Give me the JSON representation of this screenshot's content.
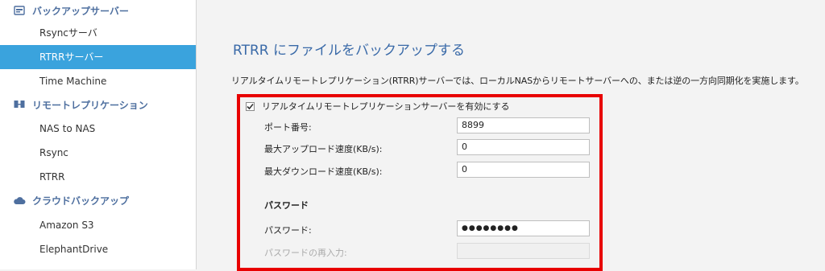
{
  "sidebar": {
    "groups": [
      {
        "label": "バックアップサーバー",
        "icon": "backup-server-icon",
        "items": [
          "Rsyncサーバ",
          "RTRRサーバー",
          "Time Machine"
        ]
      },
      {
        "label": "リモートレプリケーション",
        "icon": "remote-replication-icon",
        "items": [
          "NAS to NAS",
          "Rsync",
          "RTRR"
        ]
      },
      {
        "label": "クラウドバックアップ",
        "icon": "cloud-icon",
        "items": [
          "Amazon S3",
          "ElephantDrive"
        ]
      }
    ],
    "active_item": "RTRRサーバー"
  },
  "main": {
    "title": "RTRR にファイルをバックアップする",
    "description": "リアルタイムリモートレプリケーション(RTRR)サーバーでは、ローカルNASからリモートサーバーへの、または逆の一方向同期化を実施します。",
    "enable_checkbox": {
      "label": "リアルタイムリモートレプリケーションサーバーを有効にする",
      "checked": true
    },
    "fields": {
      "port": {
        "label": "ポート番号:",
        "value": "8899"
      },
      "max_upload": {
        "label": "最大アップロード速度(KB/s):",
        "value": "0"
      },
      "max_download": {
        "label": "最大ダウンロード速度(KB/s):",
        "value": "0"
      }
    },
    "password_section": {
      "heading": "パスワード",
      "password": {
        "label": "パスワード:",
        "value": "●●●●●●●●"
      },
      "confirm": {
        "label": "パスワードの再入力:",
        "value": ""
      }
    }
  },
  "colors": {
    "accent": "#3aa3dd",
    "title": "#3a6aa8",
    "group_label": "#4e6f9f",
    "highlight_box": "#e80000"
  }
}
